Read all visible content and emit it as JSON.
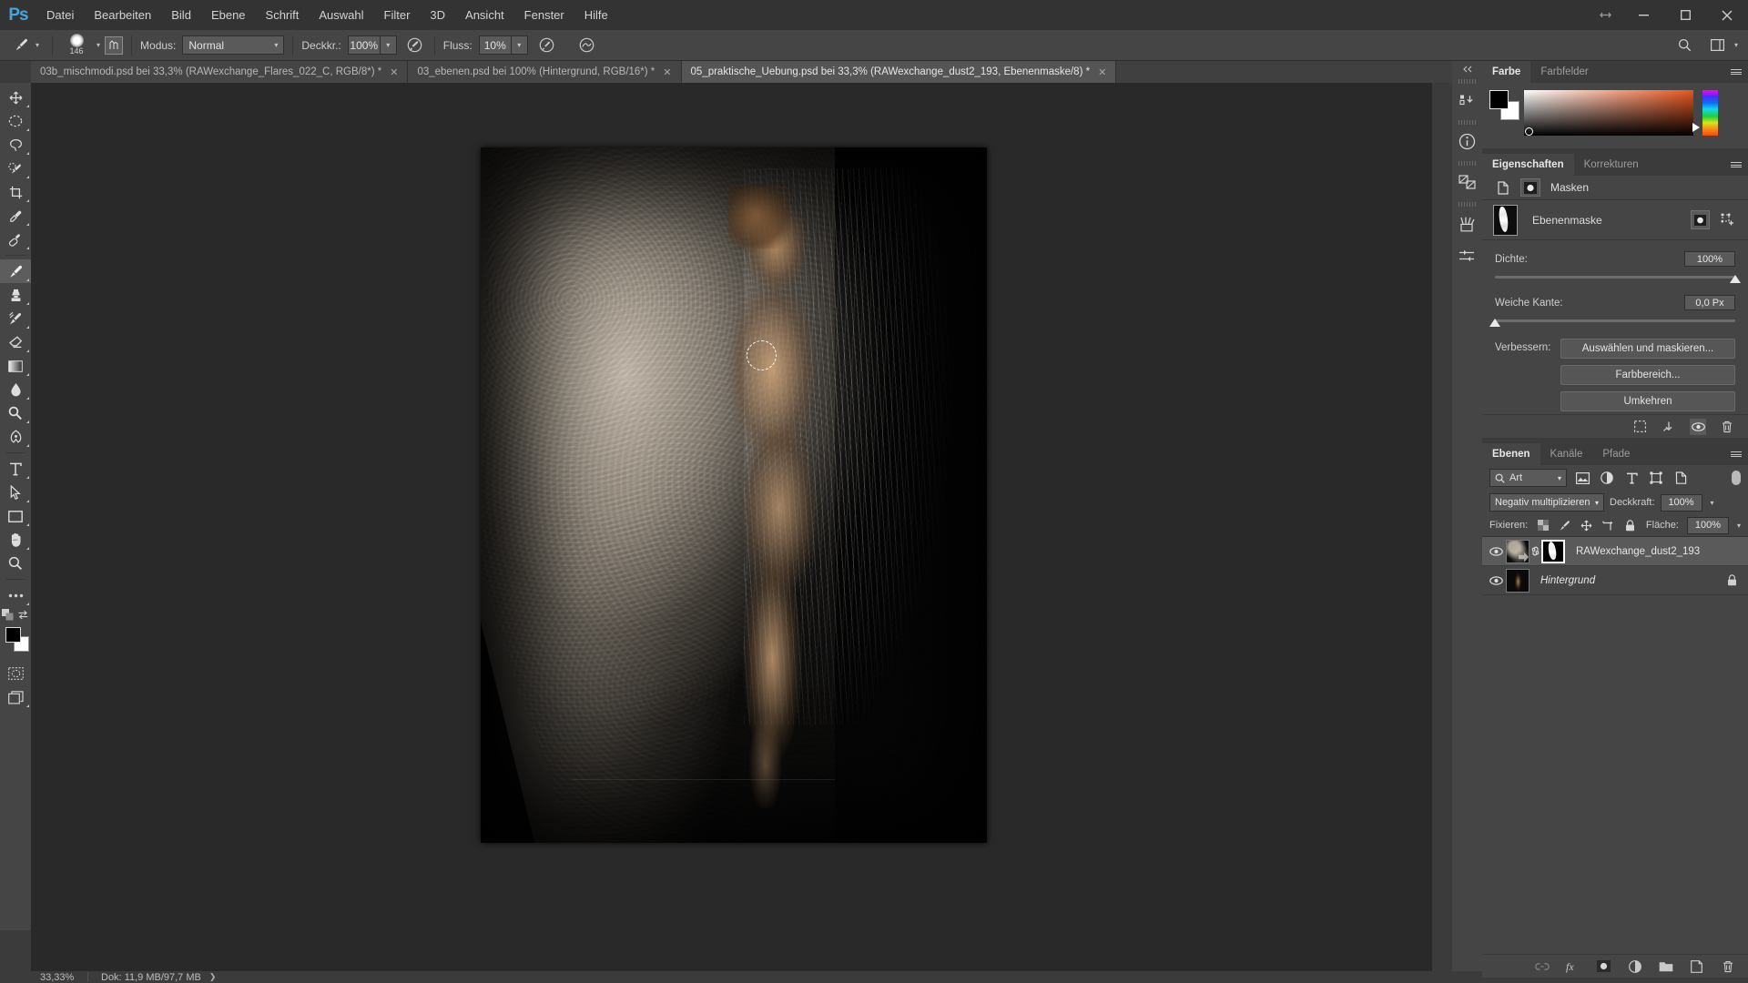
{
  "app": {
    "name": "Ps",
    "logo_color": "#4aa3df"
  },
  "menubar": {
    "items": [
      "Datei",
      "Bearbeiten",
      "Bild",
      "Ebene",
      "Schrift",
      "Auswahl",
      "Filter",
      "3D",
      "Ansicht",
      "Fenster",
      "Hilfe"
    ]
  },
  "window_controls": {
    "arrange_icon": "arrange-documents-icon",
    "minimize": "–",
    "maximize": "▢",
    "close": "✕"
  },
  "options_bar": {
    "tool_icon": "brush-tool-icon",
    "brush_size": "146",
    "brush_preset_icon": "brush-preset-picker-icon",
    "pressure_toggle_icon": "tablet-pressure-size-icon",
    "mode_label": "Modus:",
    "mode_value": "Normal",
    "opacity_label": "Deckkr.:",
    "opacity_value": "100%",
    "airbrush_icon": "airbrush-icon",
    "flow_label": "Fluss:",
    "flow_value": "10%",
    "smoothing_icon": "smoothing-icon",
    "pressure_opacity_icon": "tablet-pressure-opacity-icon",
    "search_icon": "search-icon",
    "workspace_icon": "workspace-switcher-icon",
    "extra_caret": "chevron-down-icon"
  },
  "tabs": [
    {
      "label": "03b_mischmodi.psd bei 33,3% (RAWexchange_Flares_022_C, RGB/8*) *",
      "active": false,
      "close": "✕"
    },
    {
      "label": "03_ebenen.psd bei 100% (Hintergrund, RGB/16*) *",
      "active": false,
      "close": "✕"
    },
    {
      "label": "05_praktische_Uebung.psd bei 33,3% (RAWexchange_dust2_193, Ebenenmaske/8) *",
      "active": true,
      "close": "✕"
    }
  ],
  "toolbar": {
    "groups": [
      [
        "move-tool",
        "marquee-tool",
        "lasso-tool",
        "quick-selection-tool",
        "crop-tool",
        "eyedropper-tool",
        "healing-brush-tool"
      ],
      [
        "brush-tool",
        "clone-stamp-tool",
        "history-brush-tool",
        "eraser-tool",
        "gradient-tool",
        "blur-tool",
        "dodge-tool",
        "pen-tool"
      ],
      [
        "type-tool",
        "path-selection-tool",
        "shape-tool",
        "hand-tool",
        "zoom-tool"
      ],
      [
        "edit-toolbar-ellipsis"
      ]
    ],
    "selected_tool": "brush-tool",
    "foreground_color": "#000000",
    "background_color": "#ffffff",
    "default_colors_icon": "default-colors-icon",
    "swap_colors_icon": "swap-colors-icon",
    "quickmask_icon": "quick-mask-icon",
    "screenmode_icon": "screen-mode-icon"
  },
  "statusbar": {
    "zoom": "33,33%",
    "doc_info": "Dok: 11,9 MB/97,7 MB",
    "caret": "chevron-right-icon"
  },
  "rail": {
    "collapse_icon": "collapse-panels-icon",
    "buttons": [
      {
        "name": "history-panel-icon"
      },
      {
        "name": "info-panel-icon"
      },
      {
        "name": "layer-comps-panel-icon"
      },
      {
        "name": "brushes-panel-icon"
      },
      {
        "name": "brush-settings-panel-icon"
      }
    ]
  },
  "color_panel": {
    "tabs": [
      {
        "label": "Farbe",
        "active": true
      },
      {
        "label": "Farbfelder",
        "active": false
      }
    ],
    "menu_icon": "panel-menu-icon",
    "foreground": "#000000",
    "background": "#ffffff",
    "ramp_accent": "#e8551f"
  },
  "properties_panel": {
    "tabs": [
      {
        "label": "Eigenschaften",
        "active": true
      },
      {
        "label": "Korrekturen",
        "active": false
      }
    ],
    "menu_icon": "panel-menu-icon",
    "header_label": "Masken",
    "pixel_mask_icon": "pixel-mask-icon",
    "vector_mask_icon": "vector-mask-icon",
    "mask_name": "Ebenenmaske",
    "mask_select_icon": "pixel-mask-selected-icon",
    "mask_add_vector_icon": "add-vector-mask-icon",
    "density": {
      "label": "Dichte:",
      "value": "100%",
      "percent": 100
    },
    "feather": {
      "label": "Weiche Kante:",
      "value": "0,0 Px",
      "percent": 0
    },
    "improve_label": "Verbessern:",
    "buttons": [
      {
        "label": "Auswählen und maskieren...",
        "name": "select-and-mask-button"
      },
      {
        "label": "Farbbereich...",
        "name": "color-range-button"
      },
      {
        "label": "Umkehren",
        "name": "invert-mask-button"
      }
    ],
    "footer_icons": [
      {
        "name": "load-selection-from-mask-icon"
      },
      {
        "name": "apply-mask-icon"
      },
      {
        "name": "toggle-mask-visibility-icon",
        "active": true
      },
      {
        "name": "delete-mask-icon"
      }
    ]
  },
  "layers_panel": {
    "tabs": [
      {
        "label": "Ebenen",
        "active": true
      },
      {
        "label": "Kanäle",
        "active": false
      },
      {
        "label": "Pfade",
        "active": false
      }
    ],
    "menu_icon": "panel-menu-icon",
    "filter": {
      "search_icon": "search-icon",
      "kind_value": "Art",
      "type_icons": [
        {
          "name": "filter-pixel-layers-icon"
        },
        {
          "name": "filter-adjustment-layers-icon"
        },
        {
          "name": "filter-type-layers-icon"
        },
        {
          "name": "filter-shape-layers-icon"
        },
        {
          "name": "filter-smart-objects-icon"
        }
      ],
      "toggle_name": "filter-enable-toggle"
    },
    "blend_mode": "Negativ multiplizieren",
    "opacity_label": "Deckkraft:",
    "opacity_value": "100%",
    "lock_label": "Fixieren:",
    "lock_icons": [
      {
        "name": "lock-transparent-pixels-icon"
      },
      {
        "name": "lock-image-pixels-icon"
      },
      {
        "name": "lock-position-icon"
      },
      {
        "name": "lock-artboard-nesting-icon"
      },
      {
        "name": "lock-all-icon"
      }
    ],
    "fill_label": "Fläche:",
    "fill_value": "100%",
    "layers": [
      {
        "name": "RAWexchange_dust2_193",
        "selected": true,
        "visible": true,
        "has_mask": true,
        "linked": true,
        "locked": false,
        "italic": false
      },
      {
        "name": "Hintergrund",
        "selected": false,
        "visible": true,
        "has_mask": false,
        "linked": false,
        "locked": true,
        "italic": true
      }
    ],
    "footer_icons": [
      {
        "name": "link-layers-icon",
        "dim": true
      },
      {
        "name": "layer-style-fx-icon",
        "dim": false
      },
      {
        "name": "add-layer-mask-icon",
        "dim": false
      },
      {
        "name": "new-adjustment-layer-icon",
        "dim": false
      },
      {
        "name": "new-group-icon",
        "dim": false
      },
      {
        "name": "new-layer-icon",
        "dim": false
      },
      {
        "name": "delete-layer-icon",
        "dim": false
      }
    ]
  },
  "canvas": {
    "document_name": "05_praktische_Uebung.psd",
    "zoom": "33,33%",
    "brush_cursor_label": "brush-cursor-ring"
  }
}
